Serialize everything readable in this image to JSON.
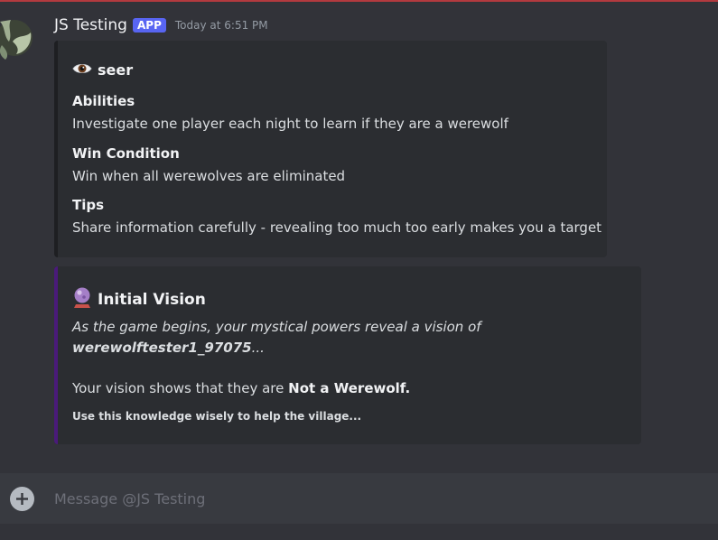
{
  "message": {
    "author": "JS Testing",
    "badge": "APP",
    "timestamp": "Today at 6:51 PM"
  },
  "embed1": {
    "title": "seer",
    "title_icon": "eye-icon",
    "fields": [
      {
        "name": "Abilities",
        "value": "Investigate one player each night to learn if they are a werewolf"
      },
      {
        "name": "Win Condition",
        "value": "Win when all werewolves are eliminated"
      },
      {
        "name": "Tips",
        "value": "Share information carefully - revealing too much too early makes you a target"
      }
    ]
  },
  "embed2": {
    "title": "Initial Vision",
    "title_icon": "crystal-ball-icon",
    "accent_color": "#4a1a7a",
    "desc_line1": "As the game begins, your mystical powers reveal a vision of",
    "target_name": "werewolftester1_97075",
    "ellipsis": "...",
    "result_prefix": "Your vision shows that they are ",
    "result_value": "Not a Werewolf.",
    "footer": "Use this knowledge wisely to help the village..."
  },
  "composer": {
    "placeholder": "Message @JS Testing"
  }
}
